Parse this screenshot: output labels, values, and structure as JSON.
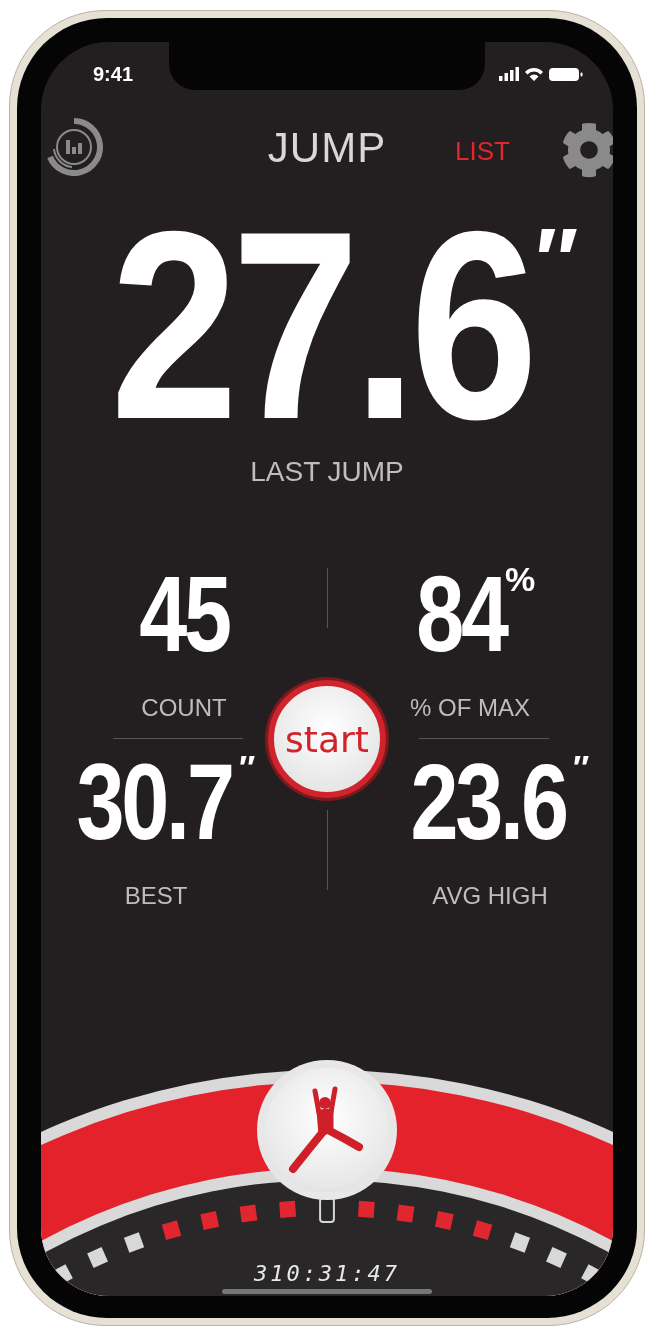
{
  "status_bar": {
    "time": "9:41"
  },
  "header": {
    "title": "JUMP",
    "list_link": "LIST"
  },
  "main_stat": {
    "value": "27.6",
    "unit": "″",
    "label": "LAST JUMP"
  },
  "stats": [
    {
      "value": "45",
      "label": "COUNT"
    },
    {
      "value": "84",
      "unit": "%",
      "label": "% OF MAX"
    },
    {
      "value": "30.7",
      "unit": "″",
      "label": "BEST"
    },
    {
      "value": "23.6",
      "unit": "″",
      "label": "AVG HIGH"
    }
  ],
  "start_button": "start",
  "dial": {
    "readout": "310:31:47"
  }
}
